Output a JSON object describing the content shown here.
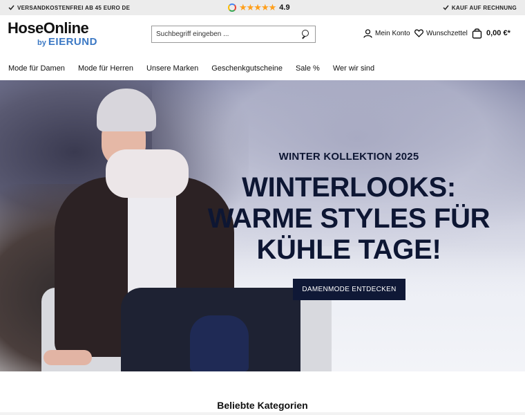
{
  "topbar": {
    "shipping_text": "VERSANDKOSTENFREI AB 45 EURO DE",
    "rating_value": "4.9",
    "invoice_text": "KAUF AUF RECHNUNG"
  },
  "header": {
    "logo_main": "HoseOnline",
    "logo_by": "by",
    "logo_brand": "EIERUND",
    "search_placeholder": "Suchbegriff eingeben ...",
    "account_label": "Mein Konto",
    "wishlist_label": "Wunschzettel",
    "cart_total": "0,00 €*"
  },
  "nav": {
    "items": [
      {
        "label": "Mode für Damen"
      },
      {
        "label": "Mode für Herren"
      },
      {
        "label": "Unsere Marken"
      },
      {
        "label": "Geschenkgutscheine"
      },
      {
        "label": "Sale %"
      },
      {
        "label": "Wer wir sind"
      }
    ]
  },
  "hero": {
    "kicker": "WINTER KOLLEKTION 2025",
    "title_line1": "WINTERLOOKS:",
    "title_line2": "WARME STYLES FÜR",
    "title_line3": "KÜHLE TAGE!",
    "button_label": "DAMENMODE ENTDECKEN"
  },
  "sections": {
    "categories_title": "Beliebte Kategorien"
  },
  "colors": {
    "hero_text": "#0d1633",
    "button_bg": "#0f1836",
    "brand_blue": "#3b78c4",
    "star": "#ff9f1a"
  },
  "icons": [
    "check-icon",
    "google-icon",
    "star-icon",
    "search-icon",
    "user-icon",
    "heart-icon",
    "cart-icon"
  ]
}
